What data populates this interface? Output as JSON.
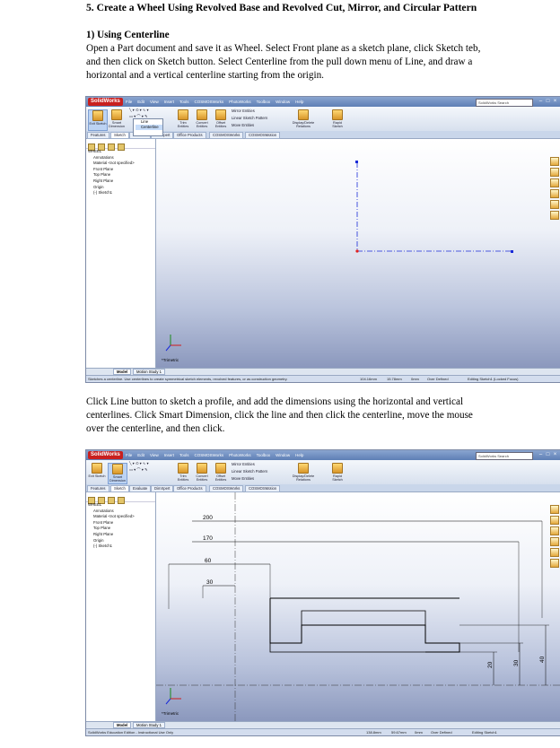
{
  "heading": "5. Create a Wheel Using Revolved Base and Revolved  Cut, Mirror, and  Circular Pattern",
  "subheading": "1) Using  Centerline",
  "para1": [
    "Open a Part document and save it as Wheel. Select Front plane as a sketch plane, click Sketch teb,",
    "and then click on Sketch button. Select Centerline from the pull down menu of Line, and draw a",
    "horizontal and a vertical centerline starting from the origin."
  ],
  "para2": [
    "Click Line button to sketch a profile, and add the dimensions using the horizontal and vertical",
    "centerlines. Click Smart Dimension, click the line and then click the centerline, move the mouse",
    "over the centerline, and then click."
  ],
  "app": {
    "logo": "SolidWorks",
    "menus": [
      "File",
      "Edit",
      "View",
      "Insert",
      "Tools",
      "COSMOSWorks",
      "PhotoWorks",
      "Toolbox",
      "Window",
      "Help"
    ],
    "search": "SolidWorks Search",
    "ribbon": {
      "exit_sketch": "Exit Sketch",
      "smart_dimension": "Smart Dimension",
      "trim": "Trim Entities",
      "convert": "Convert Entities",
      "offset": "Offset Entities",
      "mirror": "Mirror Entities",
      "linear_pattern": "Linear Sketch Pattern",
      "move": "Move Entities",
      "display_relations": "Display/Delete Relations",
      "rapid_sketch": "Rapid Sketch"
    },
    "line_menu": [
      "Line",
      "Centerline"
    ],
    "tabs": [
      "Features",
      "Sketch",
      "Evaluate",
      "DimXpert",
      "Office Products",
      "COSMOSWorks",
      "COSMOSMotion"
    ],
    "tree": [
      "WHEEL",
      "Annotations",
      "Material <not specified>",
      "Front Plane",
      "Top Plane",
      "Right Plane",
      "Origin",
      "(-) Sketch1"
    ],
    "bottom_tabs": [
      "Model",
      "Motion Study 1"
    ],
    "view_label": "*Trimetric"
  },
  "shot1": {
    "status": [
      "Sketches a centerline. Use centerlines to create symmetrical sketch elements, revolved features, or as construction geometry.",
      "104.16mm",
      "15.78mm",
      "0mm",
      "Over Defined",
      "Editing Sketch1 (Locked Focus)"
    ]
  },
  "shot2": {
    "dims": [
      "200",
      "170",
      "60",
      "30",
      "20",
      "30",
      "40"
    ],
    "status": [
      "SolidWorks Education Edition - Instructional Use Only",
      "138.8mm",
      "59.67mm",
      "0mm",
      "Over Defined",
      "Editing Sketch1"
    ]
  }
}
